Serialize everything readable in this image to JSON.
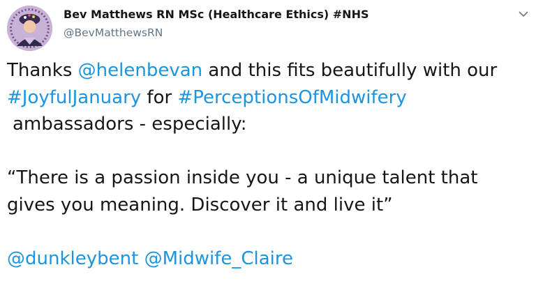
{
  "author": {
    "display_name": "Bev Matthews RN MSc (Healthcare Ethics) #NHS",
    "handle": "@BevMatthewsRN"
  },
  "tweet": {
    "line1": {
      "pre": "Thanks ",
      "mention": "@helenbevan",
      "post": " and this fits beautifully with our"
    },
    "line2": {
      "hashtag1": "#JoyfulJanuary",
      "mid": " for ",
      "hashtag2": "#PerceptionsOfMidwifery"
    },
    "line3": "ambassadors - especially:",
    "quote_line1": "“There is a passion inside you - a unique talent that",
    "quote_line2": "gives you meaning. Discover it and live it”",
    "mentions": [
      "@dunkleybent",
      "@Midwife_Claire"
    ]
  },
  "icons": {
    "menu": "chevron-down-icon",
    "avatar": "profile-photo"
  },
  "colors": {
    "link": "#1b95e0",
    "text": "#14171a",
    "secondary": "#657786"
  }
}
